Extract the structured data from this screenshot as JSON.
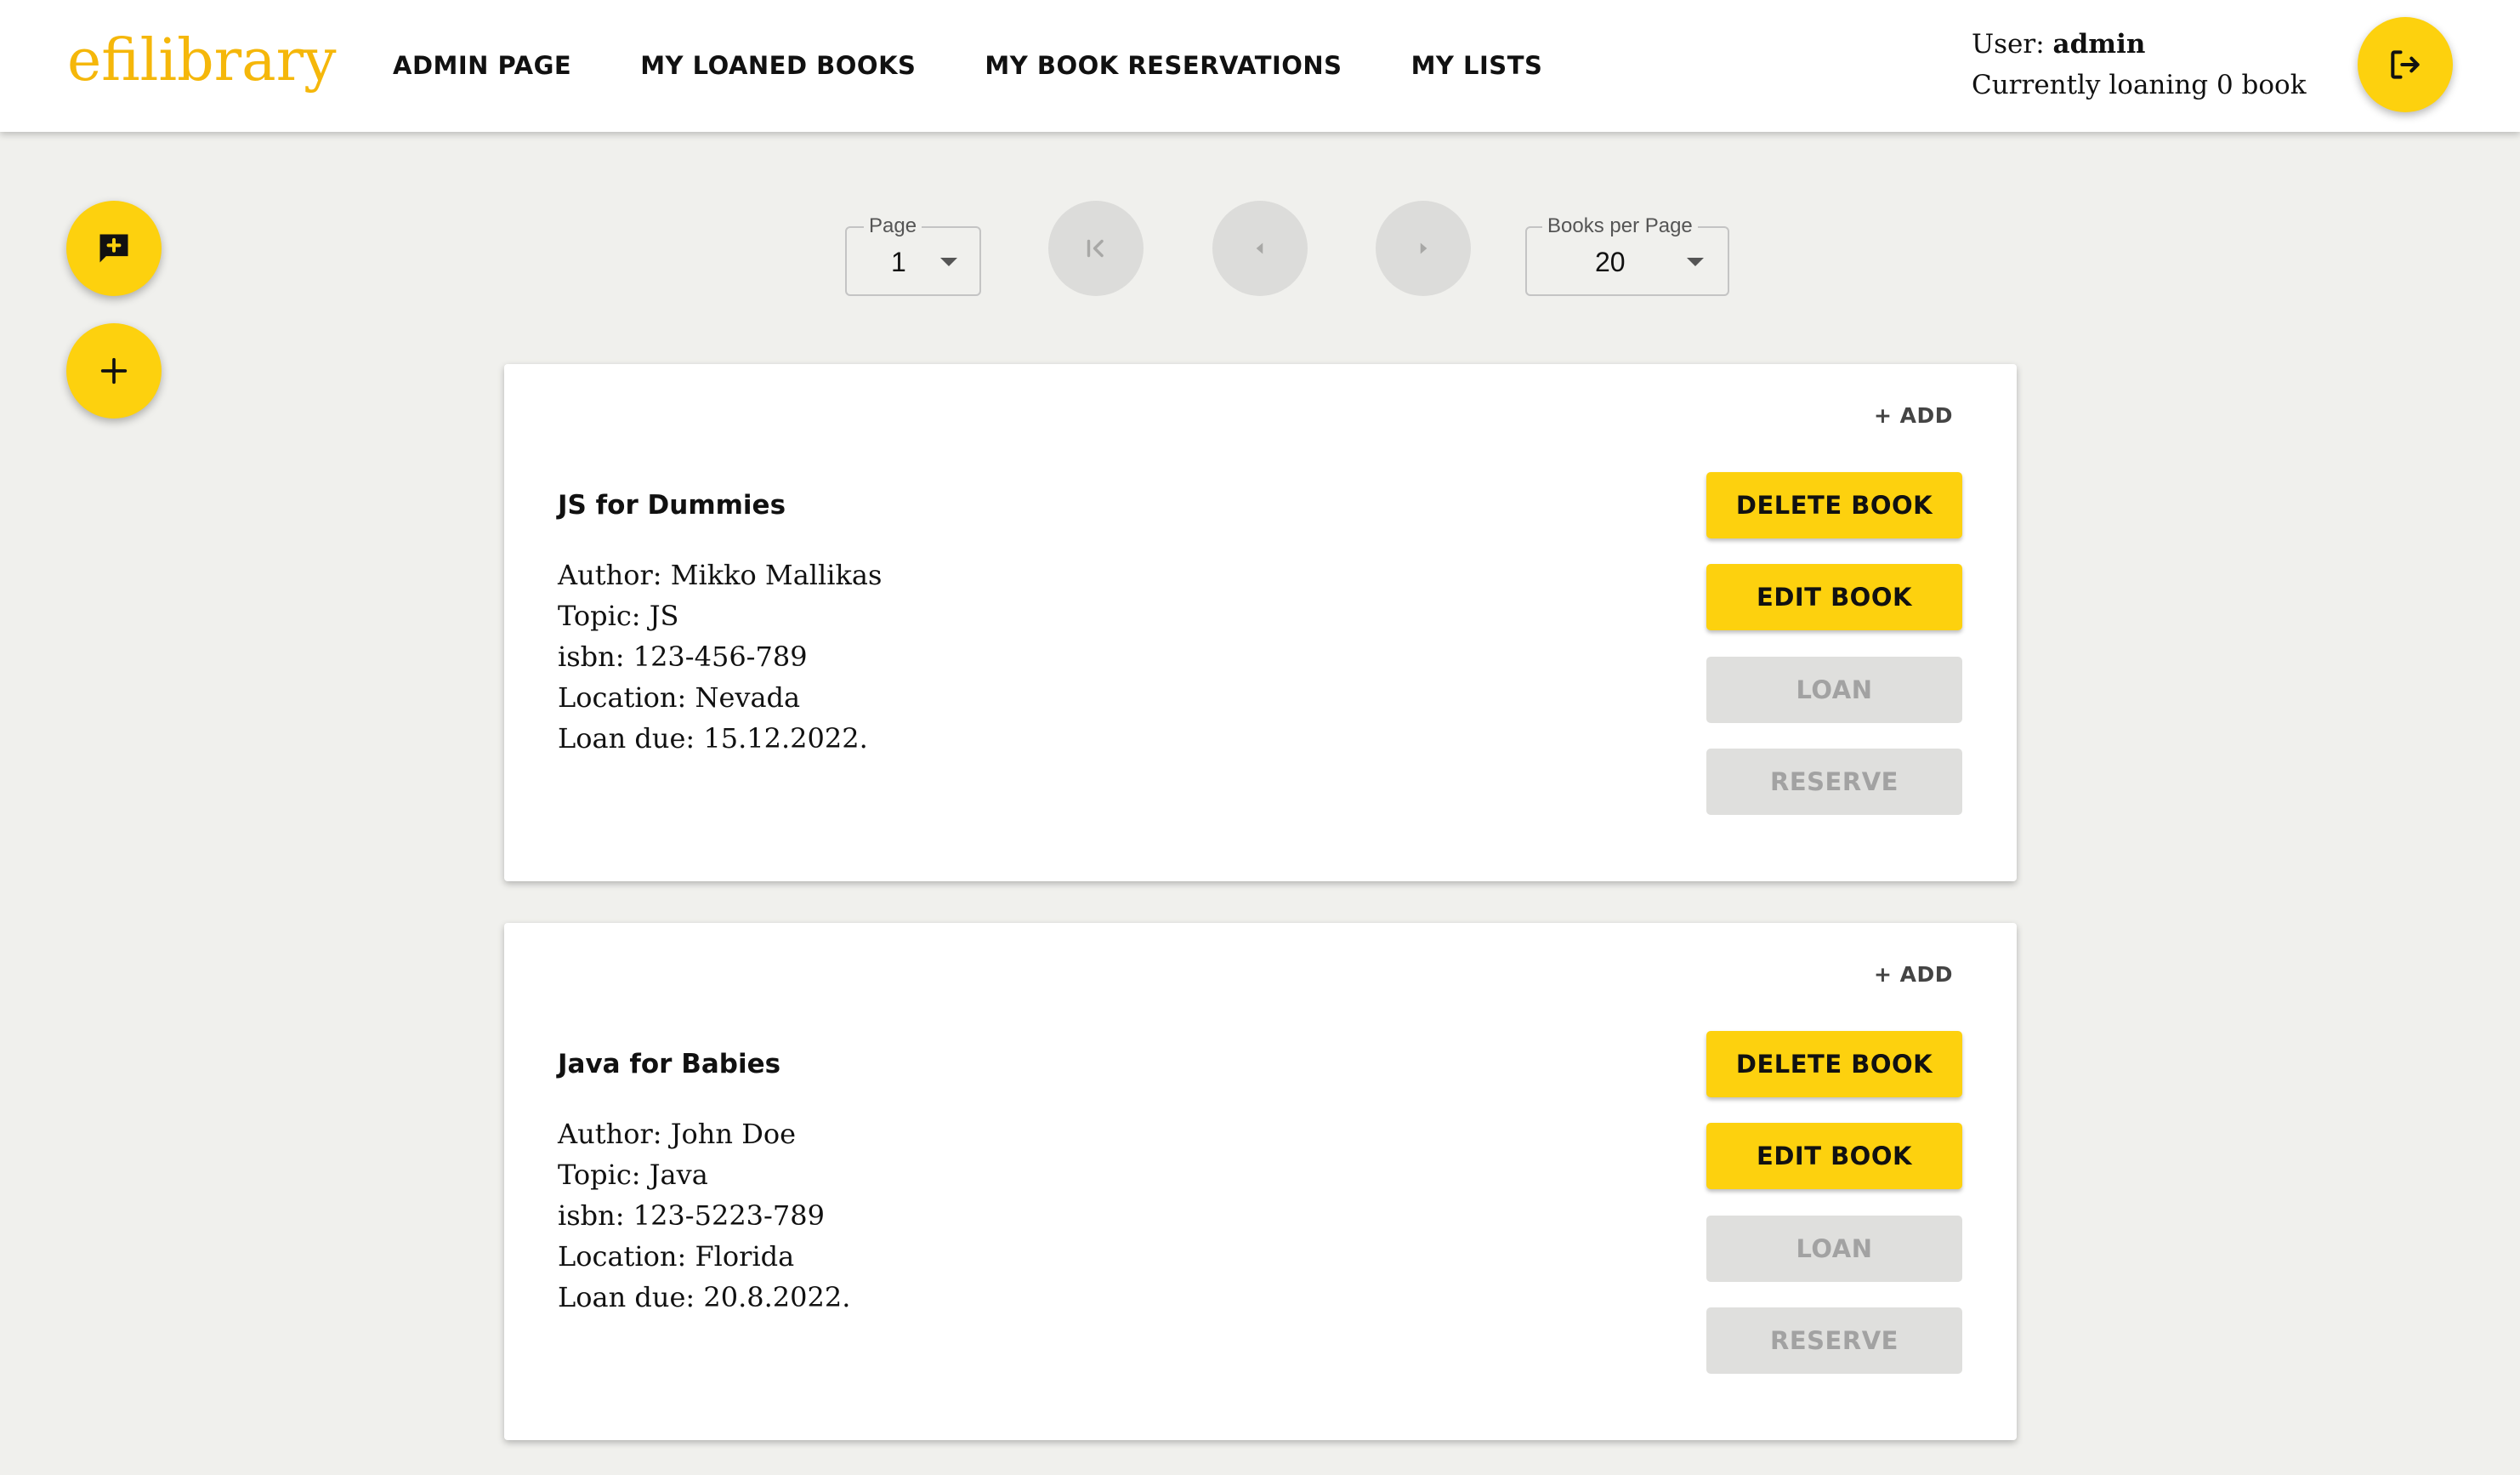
{
  "header": {
    "logo": "efilibrary",
    "nav": [
      {
        "label": "ADMIN PAGE"
      },
      {
        "label": "MY LOANED BOOKS"
      },
      {
        "label": "MY BOOK RESERVATIONS"
      },
      {
        "label": "MY LISTS"
      }
    ],
    "user_prefix": "User: ",
    "user_name": "admin",
    "loan_status": "Currently loaning 0 book",
    "logout_icon": "logout-icon"
  },
  "side_actions": {
    "add_list_icon": "add-comment-icon",
    "add_book_icon": "plus-icon"
  },
  "pagination": {
    "page_label": "Page",
    "page_value": "1",
    "per_page_label": "Books per Page",
    "per_page_value": "20",
    "first_icon": "first-page-icon",
    "prev_icon": "chevron-left-icon",
    "next_icon": "chevron-right-icon"
  },
  "books": [
    {
      "add_label": "+ ADD",
      "title": "JS for Dummies",
      "author": "Author: Mikko Mallikas",
      "topic": "Topic: JS",
      "isbn": "isbn: 123-456-789",
      "location": "Location: Nevada",
      "loan_due": "Loan due: 15.12.2022.",
      "delete_label": "DELETE BOOK",
      "edit_label": "EDIT BOOK",
      "loan_label": "LOAN",
      "reserve_label": "RESERVE"
    },
    {
      "add_label": "+ ADD",
      "title": "Java for Babies",
      "author": "Author: John Doe",
      "topic": "Topic: Java",
      "isbn": "isbn: 123-5223-789",
      "location": "Location: Florida",
      "loan_due": "Loan due: 20.8.2022.",
      "delete_label": "DELETE BOOK",
      "edit_label": "EDIT BOOK",
      "loan_label": "LOAN",
      "reserve_label": "RESERVE"
    }
  ],
  "colors": {
    "accent": "#fdd10e",
    "logo": "#f5b70a",
    "background": "#f0f0ed",
    "disabled_bg": "#dfdfdd",
    "disabled_text": "#a2a2a2"
  }
}
